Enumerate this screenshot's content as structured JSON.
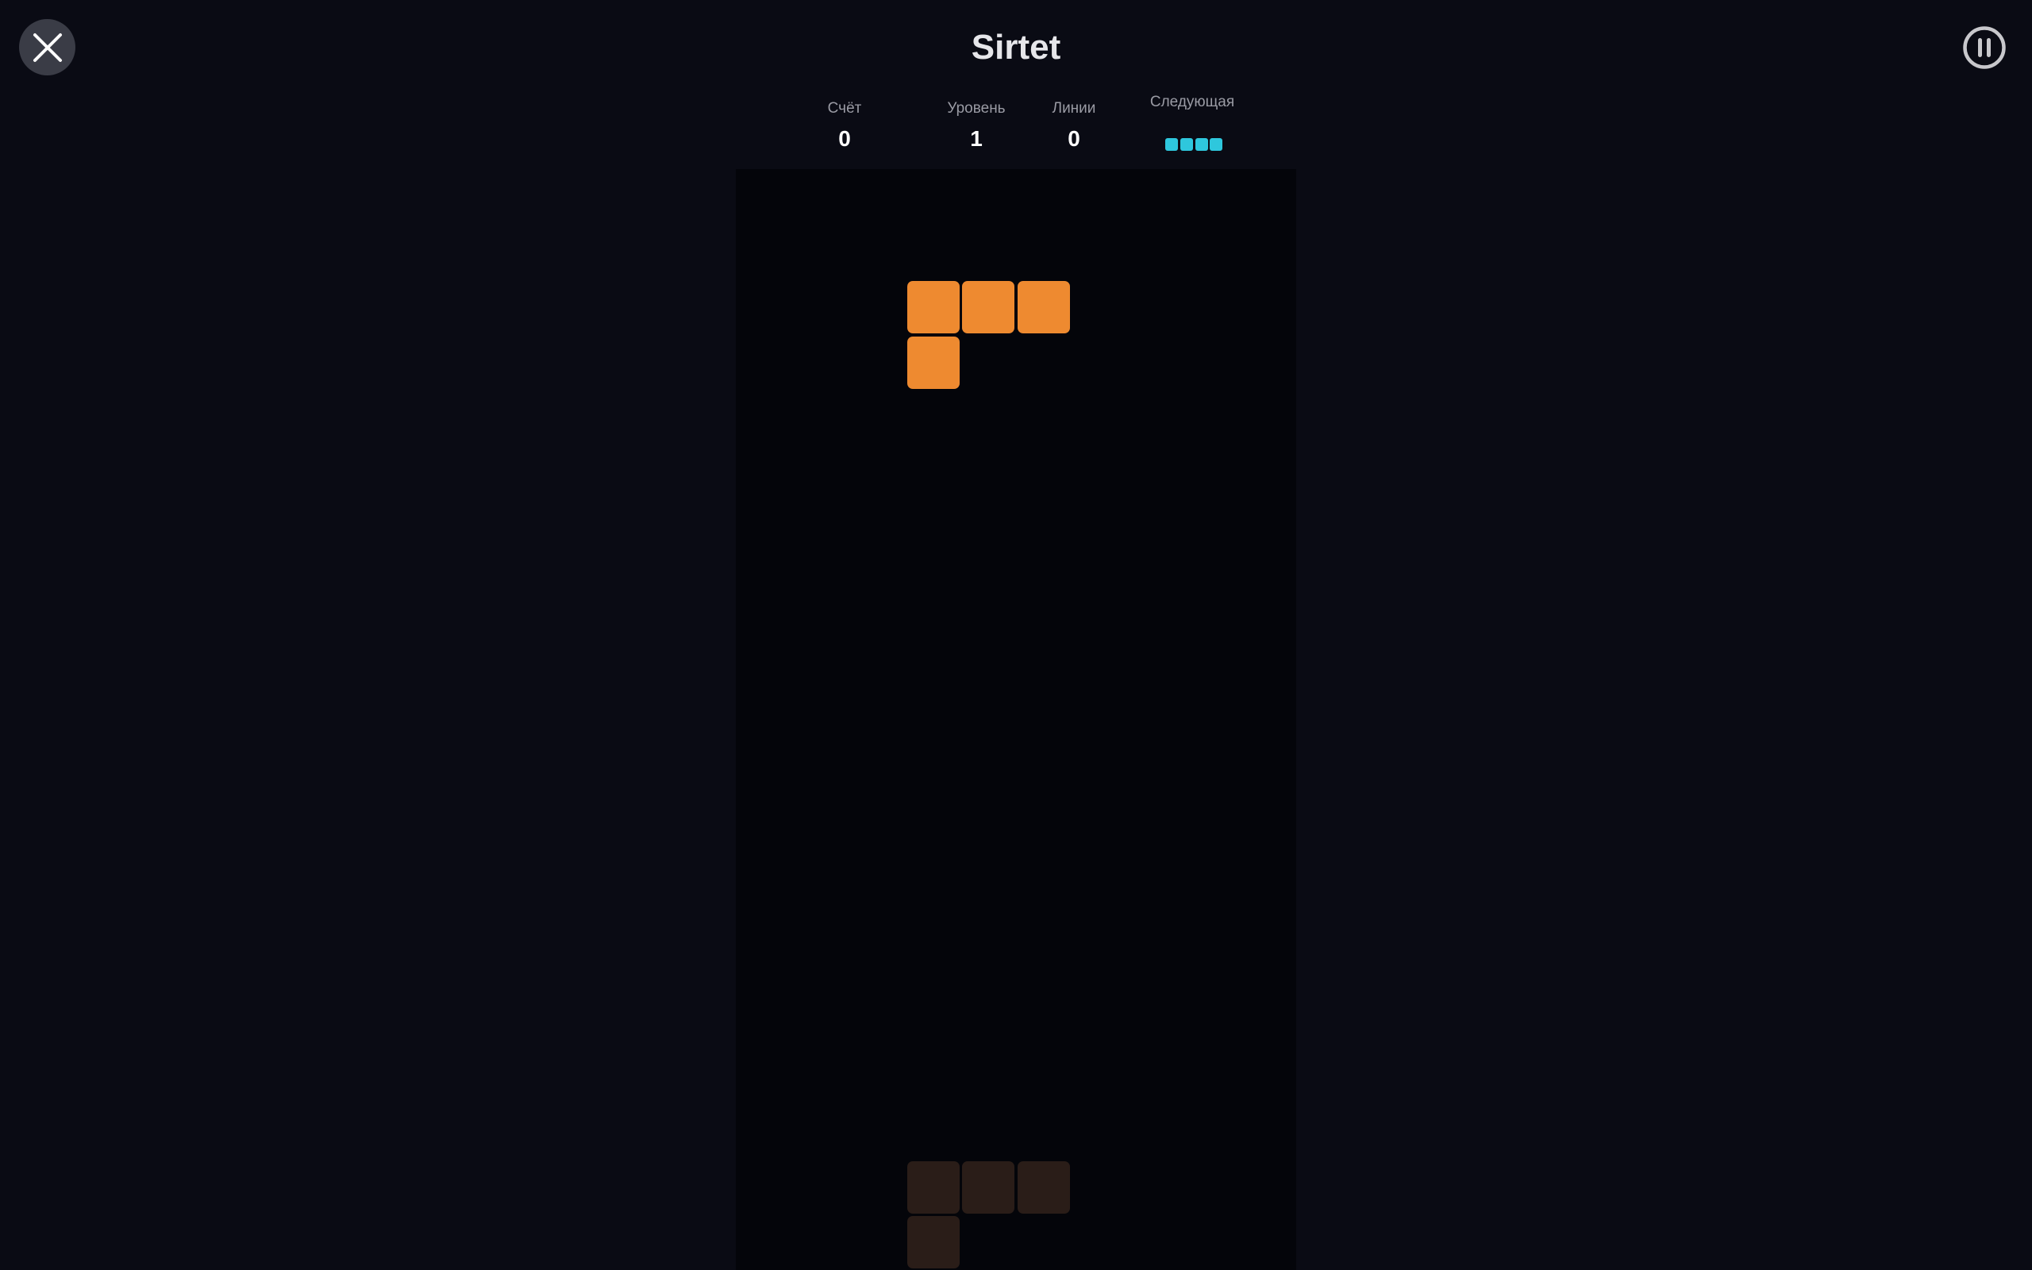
{
  "header": {
    "title": "Sirtet"
  },
  "stats": {
    "score_label": "Счёт",
    "score_value": "0",
    "level_label": "Уровень",
    "level_value": "1",
    "lines_label": "Линии",
    "lines_value": "0",
    "next_label": "Следующая"
  },
  "next_piece": {
    "shape": "I",
    "color": "#2ec7dd"
  },
  "active_piece": {
    "shape": "L",
    "color": "#ee8a30"
  },
  "ghost_piece": {
    "color": "#2a1d18"
  },
  "icons": {
    "close": "close-icon",
    "pause": "pause-icon"
  },
  "colors": {
    "background": "#0a0b14",
    "board": "#04050a",
    "close_button": "#3a3c46"
  }
}
